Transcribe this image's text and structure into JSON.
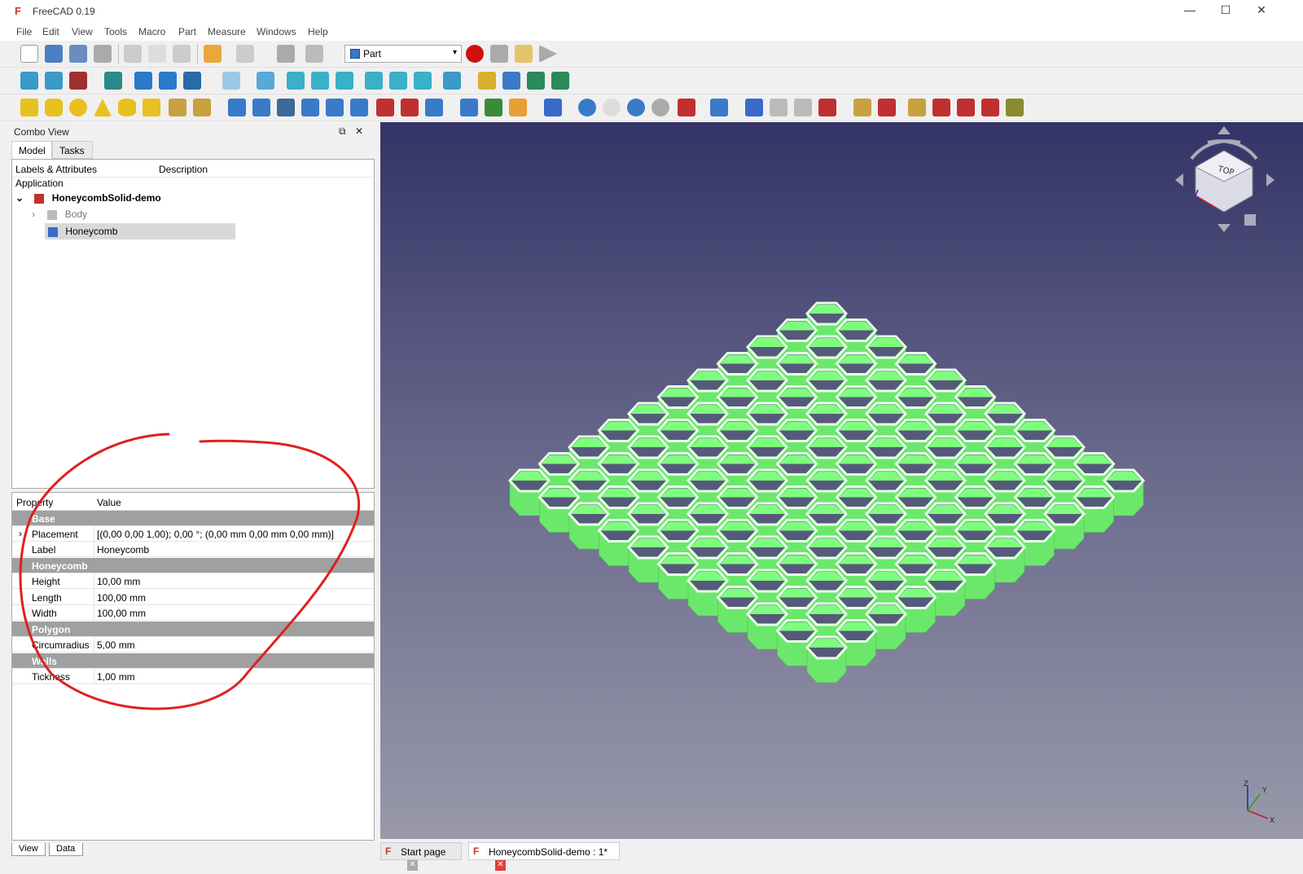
{
  "window": {
    "title": "FreeCAD 0.19"
  },
  "menu": [
    "File",
    "Edit",
    "View",
    "Tools",
    "Macro",
    "Part",
    "Measure",
    "Windows",
    "Help"
  ],
  "toolbar": {
    "workbench": "Part"
  },
  "combo": {
    "title": "Combo View",
    "tabs": [
      "Model",
      "Tasks"
    ],
    "tree_headers": [
      "Labels & Attributes",
      "Description"
    ],
    "application_label": "Application",
    "document": "HoneycombSolid-demo",
    "items": [
      {
        "label": "Body"
      },
      {
        "label": "Honeycomb"
      }
    ]
  },
  "properties": {
    "headers": [
      "Property",
      "Value"
    ],
    "rows": [
      {
        "type": "group",
        "name": "Base"
      },
      {
        "type": "prop",
        "name": "Placement",
        "value": "[(0,00 0,00 1,00); 0,00 °; (0,00 mm  0,00 mm  0,00 mm)]"
      },
      {
        "type": "prop",
        "name": "Label",
        "value": "Honeycomb"
      },
      {
        "type": "group",
        "name": "Honeycomb"
      },
      {
        "type": "prop",
        "name": "Height",
        "value": "10,00 mm"
      },
      {
        "type": "prop",
        "name": "Length",
        "value": "100,00 mm"
      },
      {
        "type": "prop",
        "name": "Width",
        "value": "100,00 mm"
      },
      {
        "type": "group",
        "name": "Polygon"
      },
      {
        "type": "prop",
        "name": "Circumradius",
        "value": "5,00 mm"
      },
      {
        "type": "group",
        "name": "Walls"
      },
      {
        "type": "prop",
        "name": "Tickness",
        "value": "1,00 mm"
      }
    ],
    "bottom_tabs": [
      "View",
      "Data"
    ]
  },
  "navcube": {
    "face": "TOP"
  },
  "doc_tabs": [
    {
      "label": "Start page",
      "active": false
    },
    {
      "label": "HoneycombSolid-demo : 1*",
      "active": true
    }
  ],
  "colors": {
    "model": "#7dff7d",
    "highlight_circle": "#e02020",
    "bg_top": "#333366",
    "bg_bottom": "#9999aa"
  }
}
